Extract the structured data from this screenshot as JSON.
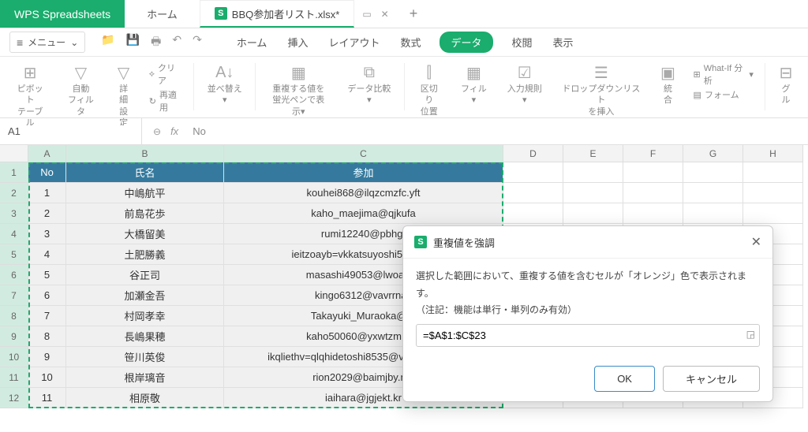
{
  "app_name": "WPS Spreadsheets",
  "top_tabs": {
    "home": "ホーム",
    "file_name": "BBQ参加者リスト.xlsx*"
  },
  "menu_label": "メニュー",
  "ribbon_tabs": [
    "ホーム",
    "挿入",
    "レイアウト",
    "数式",
    "データ",
    "校閲",
    "表示"
  ],
  "ribbon_active_index": 4,
  "ribbon_groups": {
    "pivot": "ピボット\nテーブル",
    "autofilter": "自動\nフィルタ",
    "detail": "詳細\n設定",
    "clear": "クリア",
    "reapply": "再適用",
    "sort": "並べ替え",
    "highlight_dup": "重複する値を\n蛍光ペンで表示",
    "data_compare": "データ比較",
    "text_to_cols": "区切り\n位置",
    "fill": "フィル",
    "validation": "入力規則",
    "dropdown": "ドロップダウンリスト\nを挿入",
    "consolidate": "統合",
    "whatif": "What-If 分析",
    "form": "フォーム",
    "group": "グル"
  },
  "namebox": "A1",
  "formula_value": "No",
  "columns": [
    "A",
    "B",
    "C",
    "D",
    "E",
    "F",
    "G",
    "H"
  ],
  "header_row": {
    "no": "No",
    "name": "氏名",
    "attend": "参加"
  },
  "rows": [
    {
      "no": "1",
      "name": "中嶋航平",
      "mail": "kouhei868@ilqzcmzfc.yft"
    },
    {
      "no": "2",
      "name": "前島花歩",
      "mail": "kaho_maejima@qjkufa"
    },
    {
      "no": "3",
      "name": "大橋留美",
      "mail": "rumi12240@pbhg."
    },
    {
      "no": "4",
      "name": "土肥勝義",
      "mail": "ieitzoayb=vkkatsuyoshi5849@c"
    },
    {
      "no": "5",
      "name": "谷正司",
      "mail": "masashi49053@lwoadac"
    },
    {
      "no": "6",
      "name": "加瀬金吾",
      "mail": "kingo6312@vavrrnav"
    },
    {
      "no": "7",
      "name": "村岡孝幸",
      "mail": "Takayuki_Muraoka@or"
    },
    {
      "no": "8",
      "name": "長嶋果穂",
      "mail": "kaho50060@yxwtzm.gkx"
    },
    {
      "no": "9",
      "name": "笹川英俊",
      "mail": "ikqliethv=qlqhidetoshi8535@vpxaua.px.sq"
    },
    {
      "no": "10",
      "name": "根岸璃音",
      "mail": "rion2029@baimjby.nnl"
    },
    {
      "no": "11",
      "name": "相原敬",
      "mail": "iaihara@jgjekt.kr"
    }
  ],
  "dialog": {
    "title": "重複値を強調",
    "desc1": "選択した範囲において、重複する値を含むセルが「オレンジ」色で表示されます。",
    "desc2": "（注記：機能は単行・単列のみ有効）",
    "range": "=$A$1:$C$23",
    "ok": "OK",
    "cancel": "キャンセル"
  }
}
